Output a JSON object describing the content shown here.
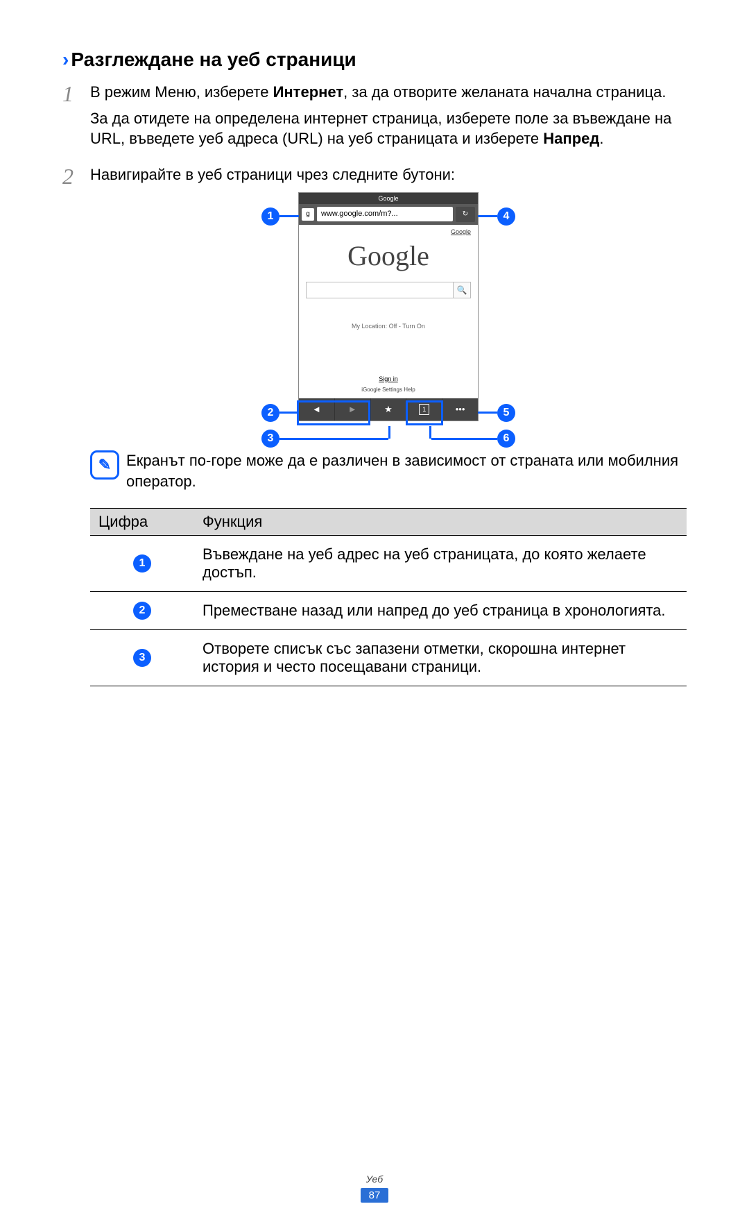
{
  "heading": "Разглеждане на уеб страници",
  "steps": {
    "s1a_pre": "В режим Меню, изберете ",
    "s1a_bold": "Интернет",
    "s1a_post": ", за да отворите желаната начална страница.",
    "s1b_pre": "За да отидете на определена интернет страница, изберете поле за въвеждане на URL, въведете уеб адреса (URL) на уеб страницата и изберете ",
    "s1b_bold": "Напред",
    "s1b_post": ".",
    "s2": "Навигирайте в уеб страници чрез следните бутони:"
  },
  "phone": {
    "title": "Google",
    "url": "www.google.com/m?...",
    "topLink": "Google",
    "logo": "Google",
    "myLocation": "My Location: Off - Turn On",
    "signIn": "Sign in",
    "bottomLinks": "iGoogle    Settings    Help",
    "windowsCount": "1"
  },
  "callouts": {
    "c1": "1",
    "c2": "2",
    "c3": "3",
    "c4": "4",
    "c5": "5",
    "c6": "6"
  },
  "note": "Екранът по-горе може да е различен в зависимост от страната или мобилния оператор.",
  "table": {
    "h1": "Цифра",
    "h2": "Функция",
    "r1": "Въвеждане на уеб адрес на уеб страницата, до която желаете достъп.",
    "r2": "Преместване назад или напред до уеб страница в хронологията.",
    "r3": "Отворете списък със запазени отметки, скорошна интернет история и често посещавани страници."
  },
  "footer": {
    "category": "Уеб",
    "page": "87"
  }
}
